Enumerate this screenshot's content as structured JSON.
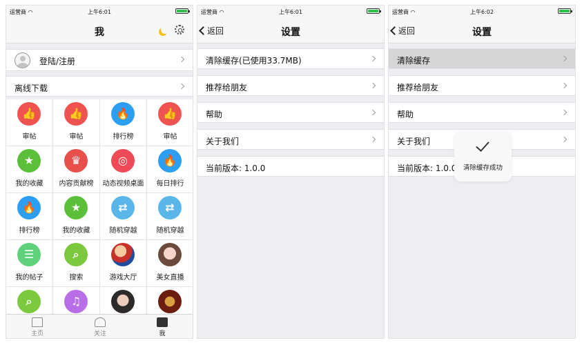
{
  "status": {
    "carrier": "运营商",
    "signal_icon": "wifi-icon"
  },
  "screen1": {
    "time": "上午6:01",
    "title": "我",
    "login_label": "登陆/注册",
    "offline_label": "离线下载",
    "grid": [
      {
        "label": "审帖",
        "icon": "thumbs-up-icon",
        "glyph": "👍",
        "color": "#ef5350"
      },
      {
        "label": "审帖",
        "icon": "thumbs-up-icon",
        "glyph": "👍",
        "color": "#ef5350"
      },
      {
        "label": "排行榜",
        "icon": "flame-icon",
        "glyph": "🔥",
        "color": "#2d9ff2"
      },
      {
        "label": "审帖",
        "icon": "thumbs-up-icon",
        "glyph": "👍",
        "color": "#ef5350"
      },
      {
        "label": "我的收藏",
        "icon": "star-icon",
        "glyph": "★",
        "color": "#5cbf3a"
      },
      {
        "label": "内容贡献榜",
        "icon": "crown-icon",
        "glyph": "♛",
        "color": "#e8504c"
      },
      {
        "label": "动态视频桌面",
        "icon": "target-icon",
        "glyph": "◎",
        "color": "#ef4a58"
      },
      {
        "label": "每日排行",
        "icon": "flame-icon",
        "glyph": "🔥",
        "color": "#2d9ff2"
      },
      {
        "label": "排行榜",
        "icon": "flame-icon",
        "glyph": "🔥",
        "color": "#2d9ff2"
      },
      {
        "label": "我的收藏",
        "icon": "star-icon",
        "glyph": "★",
        "color": "#5cbf3a"
      },
      {
        "label": "随机穿越",
        "icon": "shuffle-icon",
        "glyph": "⇄",
        "color": "#5ab6e8"
      },
      {
        "label": "随机穿越",
        "icon": "shuffle-icon",
        "glyph": "⇄",
        "color": "#5ab6e8"
      },
      {
        "label": "我的帖子",
        "icon": "document-icon",
        "glyph": "☰",
        "color": "#5fd17c"
      },
      {
        "label": "搜索",
        "icon": "search-icon",
        "glyph": "⌕",
        "color": "#7cc83e"
      },
      {
        "label": "游戏大厅",
        "icon": "mario-avatar-icon",
        "glyph": "",
        "color": "photo-mario"
      },
      {
        "label": "美女直播",
        "icon": "girl-avatar-icon",
        "glyph": "",
        "color": "photo-girl"
      },
      {
        "label": "",
        "icon": "search-icon",
        "glyph": "⌕",
        "color": "#7cc83e"
      },
      {
        "label": "",
        "icon": "music-icon",
        "glyph": "♫",
        "color": "#b86ee6"
      },
      {
        "label": "",
        "icon": "girl-avatar-icon",
        "glyph": "",
        "color": "photo-girl2"
      },
      {
        "label": "",
        "icon": "game-logo-icon",
        "glyph": "",
        "color": "photo-game"
      }
    ],
    "tabs": [
      {
        "label": "主页",
        "icon": "home-icon"
      },
      {
        "label": "关注",
        "icon": "people-icon"
      },
      {
        "label": "我",
        "icon": "inbox-icon"
      }
    ]
  },
  "screen2": {
    "time": "上午6:01",
    "title": "设置",
    "back": "返回",
    "clear_cache": "清除缓存(已使用33.7MB)",
    "recommend": "推荐给朋友",
    "help": "帮助",
    "about": "关于我们",
    "version": "当前版本: 1.0.0"
  },
  "screen3": {
    "time": "上午6:02",
    "title": "设置",
    "back": "返回",
    "clear_cache": "清除缓存",
    "recommend": "推荐给朋友",
    "help": "帮助",
    "about": "关于我们",
    "version": "当前版本: 1.0.0",
    "toast": "清除缓存成功"
  }
}
